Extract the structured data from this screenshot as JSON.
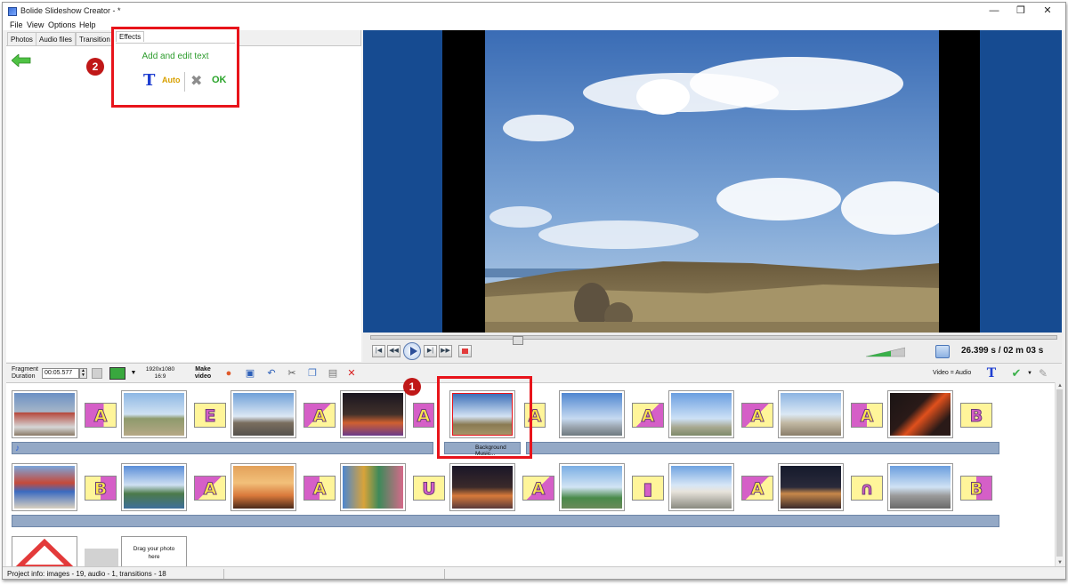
{
  "window": {
    "title": "Bolide Slideshow Creator - *",
    "controls": [
      "minimize",
      "maximize",
      "close"
    ]
  },
  "menu": [
    "File",
    "View",
    "Options",
    "Help"
  ],
  "left_tabs": [
    "Photos",
    "Audio files",
    "Transition",
    "Effects"
  ],
  "effects_panel": {
    "tab_label": "Effects",
    "title": "Add and edit text",
    "auto_label": "Auto",
    "ok_label": "OK",
    "text_tool_glyph": "T"
  },
  "badges": [
    "1",
    "2"
  ],
  "player": {
    "time_current": "26.399 s",
    "time_total": "/ 02 m 03 s",
    "seek_position_fraction": 0.21
  },
  "toolbar": {
    "fragment_label_1": "Fragment",
    "fragment_label_2": "Duration",
    "duration_value": "00:05.577",
    "resolution_1": "1920x1080",
    "resolution_2": "16:9",
    "make_1": "Make",
    "make_2": "video",
    "video_audio_label": "Video = Audio"
  },
  "timeline": {
    "row1_transitions": [
      "A",
      "E",
      "A",
      "A",
      "A",
      "A",
      "A",
      "A",
      "B"
    ],
    "row2_transitions": [
      "B",
      "A",
      "A",
      "U",
      "A",
      "▮",
      "A",
      "∩",
      "B"
    ],
    "audio_track_label": "Background Music...",
    "drop_zone_1": "Drag your photo",
    "drop_zone_2": "here"
  },
  "status": {
    "text": "Project info: images - 19, audio - 1, transitions - 18"
  },
  "colors": {
    "highlight": "#e8141b",
    "preview_bg": "#164b91",
    "effects_title": "#2c9b2c",
    "ok_green": "#2aa42a",
    "audio_bar": "#94a9c6"
  }
}
